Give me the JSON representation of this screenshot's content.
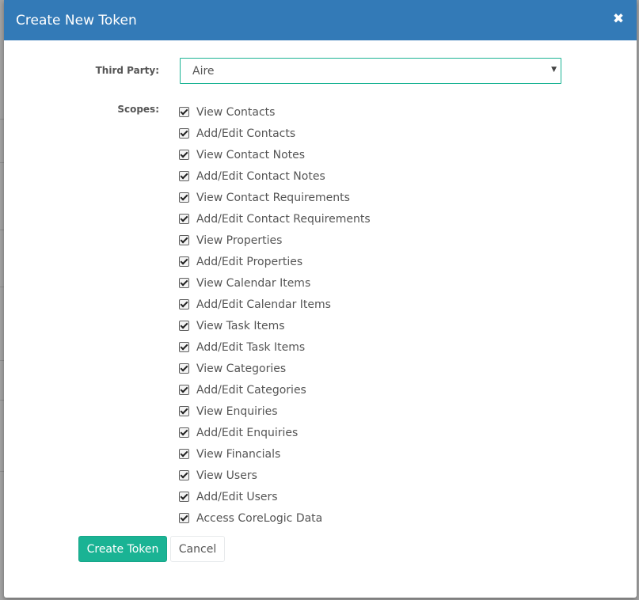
{
  "modal": {
    "title": "Create New Token",
    "close_symbol": "✖"
  },
  "form": {
    "third_party_label": "Third Party:",
    "third_party_value": "Aire",
    "scopes_label": "Scopes:"
  },
  "scopes": [
    {
      "label": "View Contacts",
      "checked": true
    },
    {
      "label": "Add/Edit Contacts",
      "checked": true
    },
    {
      "label": "View Contact Notes",
      "checked": true
    },
    {
      "label": "Add/Edit Contact Notes",
      "checked": true
    },
    {
      "label": "View Contact Requirements",
      "checked": true
    },
    {
      "label": "Add/Edit Contact Requirements",
      "checked": true
    },
    {
      "label": "View Properties",
      "checked": true
    },
    {
      "label": "Add/Edit Properties",
      "checked": true
    },
    {
      "label": "View Calendar Items",
      "checked": true
    },
    {
      "label": "Add/Edit Calendar Items",
      "checked": true
    },
    {
      "label": "View Task Items",
      "checked": true
    },
    {
      "label": "Add/Edit Task Items",
      "checked": true
    },
    {
      "label": "View Categories",
      "checked": true
    },
    {
      "label": "Add/Edit Categories",
      "checked": true
    },
    {
      "label": "View Enquiries",
      "checked": true
    },
    {
      "label": "Add/Edit Enquiries",
      "checked": true
    },
    {
      "label": "View Financials",
      "checked": true
    },
    {
      "label": "View Users",
      "checked": true
    },
    {
      "label": "Add/Edit Users",
      "checked": true
    },
    {
      "label": "Access CoreLogic Data",
      "checked": true
    }
  ],
  "buttons": {
    "create_label": "Create Token",
    "cancel_label": "Cancel"
  },
  "colors": {
    "header": "#337ab7",
    "accent": "#1ab394"
  }
}
